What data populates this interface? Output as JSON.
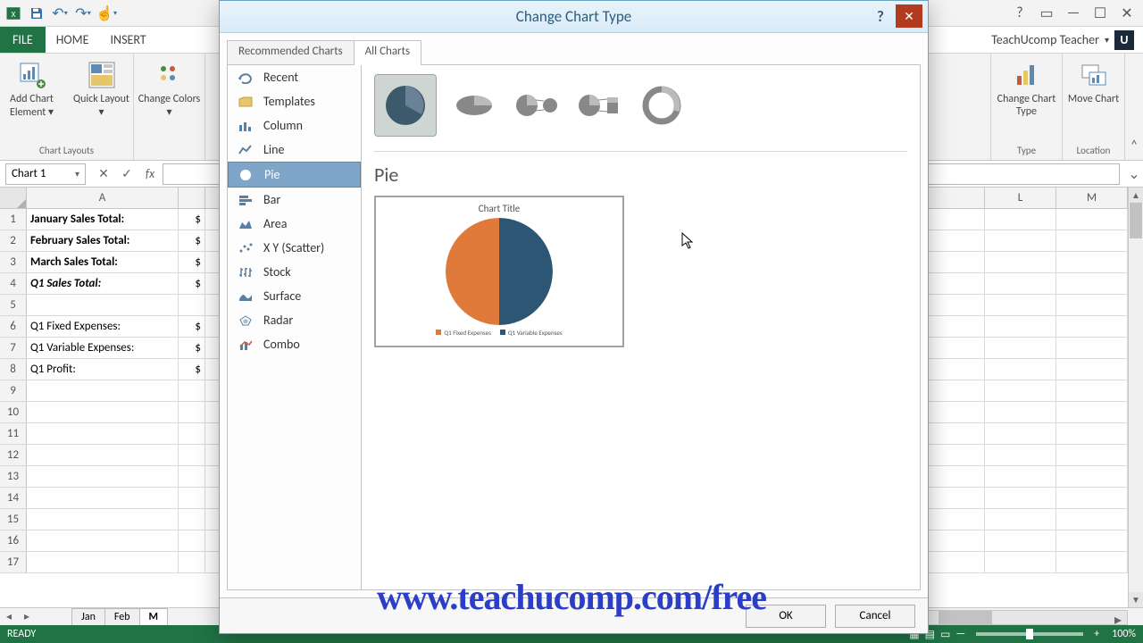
{
  "qat": {
    "undo": "↶",
    "redo": "↷"
  },
  "ribbon": {
    "tabs": {
      "file": "FILE",
      "home": "HOME",
      "insert": "INSERT"
    },
    "account": "TeachUcomp Teacher",
    "groups": {
      "chart_layouts": {
        "label": "Chart Layouts",
        "add_chart_element": "Add Chart Element ▾",
        "quick_layout": "Quick Layout ▾"
      },
      "chart_styles": {
        "change_colors": "Change Colors ▾"
      },
      "type": {
        "label": "Type",
        "change_chart_type": "Change Chart Type"
      },
      "location": {
        "label": "Location",
        "move_chart": "Move Chart"
      }
    }
  },
  "fbar": {
    "namebox": "Chart 1",
    "fx": "fx"
  },
  "grid": {
    "cols": [
      "A",
      "L",
      "M"
    ],
    "rows": [
      {
        "n": 1,
        "A": "January Sales Total:",
        "B": "$",
        "bold": true
      },
      {
        "n": 2,
        "A": "February Sales Total:",
        "B": "$",
        "bold": true
      },
      {
        "n": 3,
        "A": "March Sales Total:",
        "B": "$",
        "bold": true
      },
      {
        "n": 4,
        "A": "Q1 Sales Total:",
        "B": "$",
        "bold": true,
        "italic": true
      },
      {
        "n": 5,
        "A": "",
        "B": ""
      },
      {
        "n": 6,
        "A": "Q1 Fixed Expenses:",
        "B": "$"
      },
      {
        "n": 7,
        "A": "Q1 Variable Expenses:",
        "B": "$"
      },
      {
        "n": 8,
        "A": "Q1 Profit:",
        "B": "$"
      },
      {
        "n": 9,
        "A": "",
        "B": ""
      },
      {
        "n": 10,
        "A": "",
        "B": ""
      },
      {
        "n": 11,
        "A": "",
        "B": ""
      },
      {
        "n": 12,
        "A": "",
        "B": ""
      },
      {
        "n": 13,
        "A": "",
        "B": ""
      },
      {
        "n": 14,
        "A": "",
        "B": ""
      },
      {
        "n": 15,
        "A": "",
        "B": ""
      },
      {
        "n": 16,
        "A": "",
        "B": ""
      },
      {
        "n": 17,
        "A": "",
        "B": ""
      }
    ]
  },
  "sheets": [
    "Jan",
    "Feb",
    "M"
  ],
  "status": {
    "ready": "READY",
    "zoom": "100%"
  },
  "dialog": {
    "title": "Change Chart Type",
    "tabs": {
      "recommended": "Recommended Charts",
      "all": "All Charts"
    },
    "categories": [
      "Recent",
      "Templates",
      "Column",
      "Line",
      "Pie",
      "Bar",
      "Area",
      "X Y (Scatter)",
      "Stock",
      "Surface",
      "Radar",
      "Combo"
    ],
    "subtypes": [
      "pie",
      "pie-3d",
      "pie-of-pie",
      "bar-of-pie",
      "doughnut"
    ],
    "subtitle": "Pie",
    "preview": {
      "title": "Chart Title",
      "legend": [
        "Q1 Fixed Expenses",
        "Q1 Variable Expenses"
      ]
    },
    "ok": "OK",
    "cancel": "Cancel"
  },
  "watermark": "www.teachucomp.com/free",
  "chart_data": {
    "type": "pie",
    "title": "Chart Title",
    "categories": [
      "Q1 Fixed Expenses",
      "Q1 Variable Expenses"
    ],
    "values": [
      50,
      50
    ],
    "colors": [
      "#e07a3a",
      "#2d5574"
    ]
  }
}
